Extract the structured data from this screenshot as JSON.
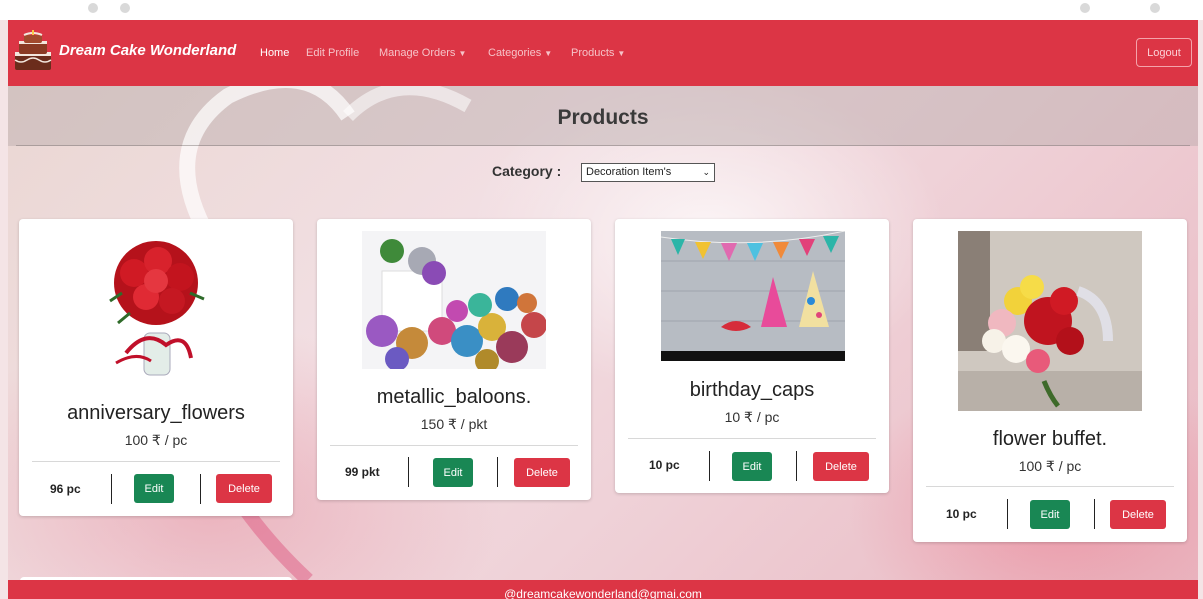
{
  "brand": {
    "name": "Dream Cake Wonderland",
    "logo_icon": "cake-icon"
  },
  "nav": {
    "home": "Home",
    "edit_profile": "Edit Profile",
    "manage_orders": "Manage Orders",
    "categories": "Categories",
    "products": "Products",
    "logout": "Logout"
  },
  "page": {
    "title": "Products",
    "category_label": "Category :",
    "category_selected": "Decoration Item's"
  },
  "products": [
    {
      "name": "anniversary_flowers",
      "price": "100 ₹ / pc",
      "stock": "96 pc",
      "edit": "Edit",
      "delete": "Delete",
      "image_icon": "rose-bouquet-image"
    },
    {
      "name": "metallic_baloons.",
      "price": "150 ₹ / pkt",
      "stock": "99 pkt",
      "edit": "Edit",
      "delete": "Delete",
      "image_icon": "balloons-image"
    },
    {
      "name": "birthday_caps",
      "price": "10 ₹ / pc",
      "stock": "10 pc",
      "edit": "Edit",
      "delete": "Delete",
      "image_icon": "party-caps-image"
    },
    {
      "name": "flower buffet.",
      "price": "100 ₹ / pc",
      "stock": "10 pc",
      "edit": "Edit",
      "delete": "Delete",
      "image_icon": "flower-bouquet-image"
    }
  ],
  "footer": {
    "email": "@dreamcakewonderland@gmai.com"
  },
  "colors": {
    "primary": "#dc3545",
    "success": "#198754",
    "text": "#222222"
  }
}
